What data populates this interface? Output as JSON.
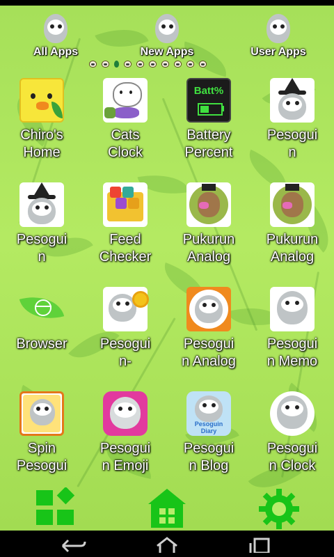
{
  "tabs": [
    {
      "label": "All Apps"
    },
    {
      "label": "New Apps"
    },
    {
      "label": "User Apps"
    }
  ],
  "page_indicator": {
    "count": 10,
    "active_index": 2
  },
  "apps": [
    {
      "line1": "Chiro's",
      "line2": "Home",
      "icon": "chick-icon"
    },
    {
      "line1": "Cats",
      "line2": "Clock",
      "icon": "cat-icon"
    },
    {
      "line1": "Battery",
      "line2": "Percent",
      "icon": "battery-icon",
      "icon_text": "Batt%"
    },
    {
      "line1": "Pesogui",
      "line2": "n",
      "icon": "penguin-witch-icon"
    },
    {
      "line1": "Pesogui",
      "line2": "n",
      "icon": "penguin-witch-icon"
    },
    {
      "line1": "Feed",
      "line2": "Checker",
      "icon": "rss-folder-icon"
    },
    {
      "line1": "Pukurun",
      "line2": "Analog",
      "icon": "teddy-bear-icon"
    },
    {
      "line1": "Pukurun",
      "line2": "Analog",
      "icon": "teddy-bear-icon"
    },
    {
      "line1": "Browser",
      "line2": "",
      "icon": "globe-leaf-icon"
    },
    {
      "line1": "Pesogui",
      "line2": "n-",
      "icon": "penguin-sunflower-icon"
    },
    {
      "line1": "Pesogui",
      "line2": "n Analog",
      "icon": "penguin-orange-icon"
    },
    {
      "line1": "Pesogui",
      "line2": "n Memo",
      "icon": "penguin-memo-icon"
    },
    {
      "line1": "Spin",
      "line2": "Pesogui",
      "icon": "penguin-spin-icon"
    },
    {
      "line1": "Pesogui",
      "line2": "n Emoji",
      "icon": "penguin-emoji-icon"
    },
    {
      "line1": "Pesogui",
      "line2": "n Blog",
      "icon": "penguin-blog-icon",
      "icon_text": "Pesoguin Diary"
    },
    {
      "line1": "Pesogui",
      "line2": "n Clock",
      "icon": "penguin-clock-icon"
    }
  ],
  "dock": [
    {
      "icon": "app-grid-icon"
    },
    {
      "icon": "home-icon"
    },
    {
      "icon": "settings-gear-icon"
    }
  ],
  "nav": [
    {
      "icon": "back-icon"
    },
    {
      "icon": "home-nav-icon"
    },
    {
      "icon": "recent-apps-icon"
    }
  ],
  "colors": {
    "accent_green": "#18c418",
    "wallpaper": "#a8e05a"
  }
}
